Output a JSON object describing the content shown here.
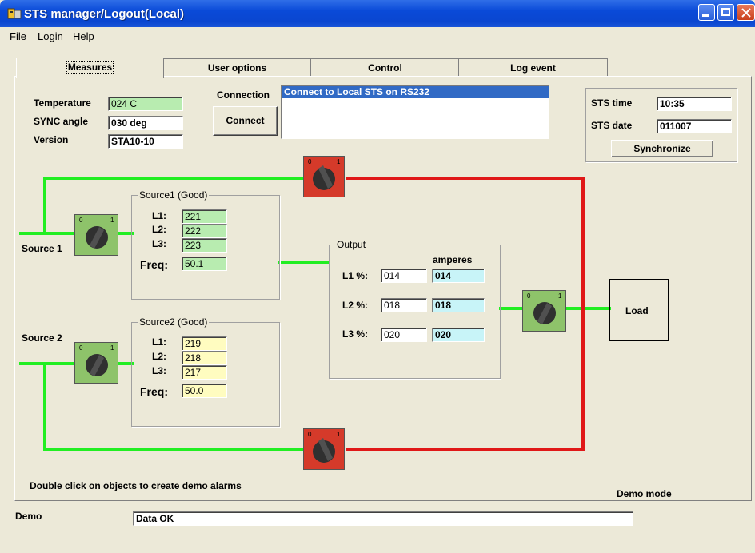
{
  "window": {
    "title": "STS manager/Logout(Local)"
  },
  "menu": [
    "File",
    "Login",
    "Help"
  ],
  "tabs": [
    "Measures",
    "User options",
    "Control",
    "Log event"
  ],
  "measures": {
    "temperature": {
      "label": "Temperature",
      "value": "024 C"
    },
    "sync_angle": {
      "label": "SYNC angle",
      "value": "030 deg"
    },
    "version": {
      "label": "Version",
      "value": "STA10-10"
    }
  },
  "connection": {
    "label": "Connection",
    "button": "Connect",
    "items": [
      "Connect to Local STS on RS232"
    ]
  },
  "sts": {
    "time_label": "STS time",
    "time_value": "10:35",
    "date_label": "STS date",
    "date_value": "011007",
    "sync_button": "Synchronize"
  },
  "source1": {
    "label": "Source 1",
    "group_title": "Source1 (Good)",
    "l1_label": "L1:",
    "l1": "221",
    "l2_label": "L2:",
    "l2": "222",
    "l3_label": "L3:",
    "l3": "223",
    "freq_label": "Freq:",
    "freq": "50.1"
  },
  "source2": {
    "label": "Source 2",
    "group_title": "Source2 (Good)",
    "l1_label": "L1:",
    "l1": "219",
    "l2_label": "L2:",
    "l2": "218",
    "l3_label": "L3:",
    "l3": "217",
    "freq_label": "Freq:",
    "freq": "50.0"
  },
  "output": {
    "group_title": "Output",
    "amperes_label": "amperes",
    "l1_label": "L1 %:",
    "l1_pct": "014",
    "l1_amp": "014",
    "l2_label": "L2 %:",
    "l2_pct": "018",
    "l2_amp": "018",
    "l3_label": "L3 %:",
    "l3_pct": "020",
    "l3_amp": "020"
  },
  "switch_labels": {
    "off": "0",
    "on": "1"
  },
  "load_label": "Load",
  "hint": "Double click on objects to create demo alarms",
  "mode": "Demo mode",
  "status": {
    "label": "Demo",
    "message": "Data OK"
  },
  "colors": {
    "line_green": "#22ee22",
    "line_red": "#e01818",
    "switch_green": "#8ec36a",
    "switch_red": "#d53a2a",
    "field_green": "#b8ecb0",
    "field_yellow": "#fffcc0",
    "field_cyan": "#c8f4f8",
    "selection": "#316ac5"
  }
}
